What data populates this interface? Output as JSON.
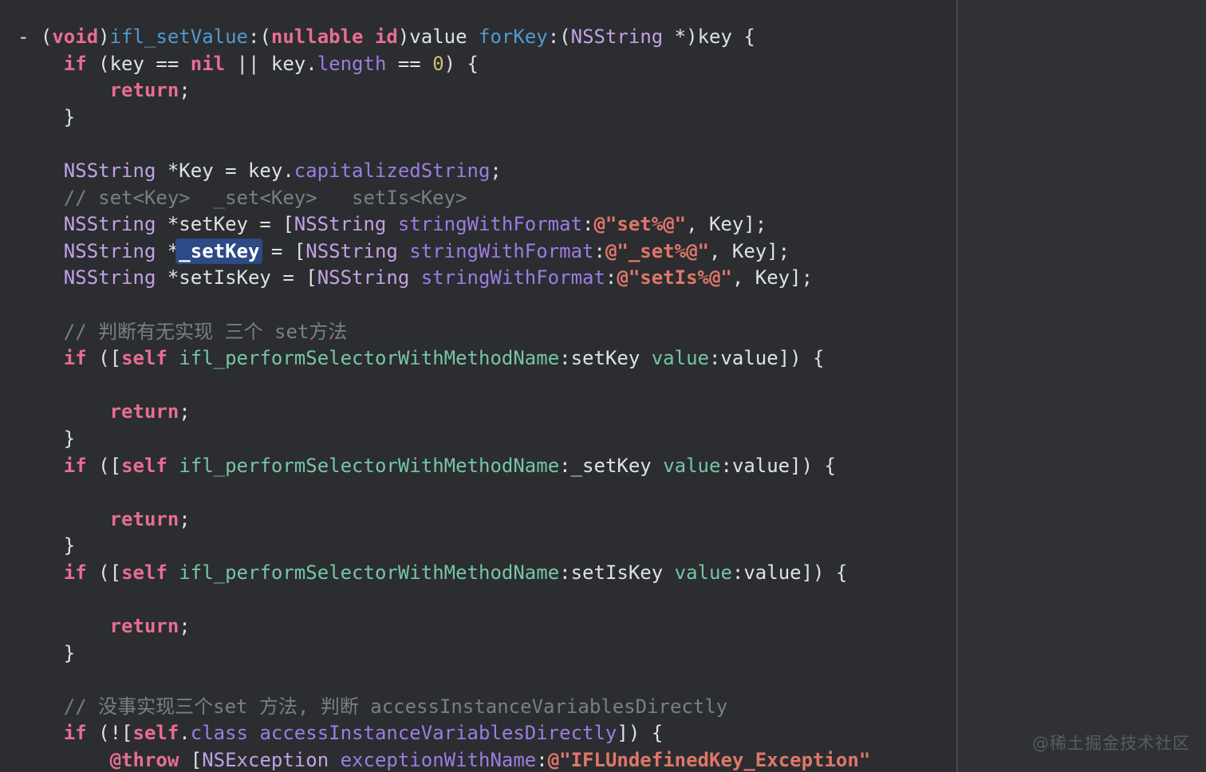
{
  "editor": {
    "language": "objective-c",
    "background": "#2b2d30",
    "panel_background": "#2f3136",
    "divider_color": "#47494e",
    "selection_color": "#2b4a86",
    "lines": [
      {
        "tokens": [
          [
            "w",
            "- ("
          ],
          [
            "k",
            "void"
          ],
          [
            "w",
            ")"
          ],
          [
            "m",
            "ifl_setValue"
          ],
          [
            "w",
            ":("
          ],
          [
            "k",
            "nullable id"
          ],
          [
            "w",
            ")value "
          ],
          [
            "m",
            "forKey"
          ],
          [
            "w",
            ":("
          ],
          [
            "cls",
            "NSString"
          ],
          [
            "w",
            " *)key {"
          ]
        ]
      },
      {
        "tokens": [
          [
            "w",
            "    "
          ],
          [
            "k",
            "if"
          ],
          [
            "w",
            " (key == "
          ],
          [
            "k",
            "nil"
          ],
          [
            "w",
            " || key."
          ],
          [
            "p",
            "length"
          ],
          [
            "w",
            " == "
          ],
          [
            "n",
            "0"
          ],
          [
            "w",
            ") {"
          ]
        ]
      },
      {
        "tokens": [
          [
            "w",
            "        "
          ],
          [
            "k",
            "return"
          ],
          [
            "w",
            ";"
          ]
        ]
      },
      {
        "tokens": [
          [
            "w",
            "    }"
          ]
        ]
      },
      {
        "tokens": []
      },
      {
        "tokens": [
          [
            "w",
            "    "
          ],
          [
            "cls",
            "NSString"
          ],
          [
            "w",
            " *Key = key."
          ],
          [
            "p",
            "capitalizedString"
          ],
          [
            "w",
            ";"
          ]
        ]
      },
      {
        "tokens": [
          [
            "c",
            "    // set<Key>  _set<Key>   setIs<Key>"
          ]
        ]
      },
      {
        "tokens": [
          [
            "w",
            "    "
          ],
          [
            "cls",
            "NSString"
          ],
          [
            "w",
            " *setKey = ["
          ],
          [
            "cls",
            "NSString"
          ],
          [
            "w",
            " "
          ],
          [
            "p",
            "stringWithFormat"
          ],
          [
            "w",
            ":"
          ],
          [
            "s",
            "@\"set%@\""
          ],
          [
            "w",
            ", Key];"
          ]
        ]
      },
      {
        "tokens": [
          [
            "w",
            "    "
          ],
          [
            "cls",
            "NSString"
          ],
          [
            "w",
            " *"
          ],
          [
            "sel",
            "_setKey"
          ],
          [
            "w",
            " = ["
          ],
          [
            "cls",
            "NSString"
          ],
          [
            "w",
            " "
          ],
          [
            "p",
            "stringWithFormat"
          ],
          [
            "w",
            ":"
          ],
          [
            "s",
            "@\"_set%@\""
          ],
          [
            "w",
            ", Key];"
          ]
        ]
      },
      {
        "tokens": [
          [
            "w",
            "    "
          ],
          [
            "cls",
            "NSString"
          ],
          [
            "w",
            " *setIsKey = ["
          ],
          [
            "cls",
            "NSString"
          ],
          [
            "w",
            " "
          ],
          [
            "p",
            "stringWithFormat"
          ],
          [
            "w",
            ":"
          ],
          [
            "s",
            "@\"setIs%@\""
          ],
          [
            "w",
            ", Key];"
          ]
        ]
      },
      {
        "tokens": []
      },
      {
        "tokens": [
          [
            "c",
            "    // 判断有无实现 三个 set方法"
          ]
        ]
      },
      {
        "tokens": [
          [
            "w",
            "    "
          ],
          [
            "k",
            "if"
          ],
          [
            "w",
            " (["
          ],
          [
            "k",
            "self"
          ],
          [
            "w",
            " "
          ],
          [
            "t",
            "ifl_performSelectorWithMethodName"
          ],
          [
            "w",
            ":setKey "
          ],
          [
            "t",
            "value"
          ],
          [
            "w",
            ":value]) {"
          ]
        ]
      },
      {
        "tokens": []
      },
      {
        "tokens": [
          [
            "w",
            "        "
          ],
          [
            "k",
            "return"
          ],
          [
            "w",
            ";"
          ]
        ]
      },
      {
        "tokens": [
          [
            "w",
            "    }"
          ]
        ]
      },
      {
        "tokens": [
          [
            "w",
            "    "
          ],
          [
            "k",
            "if"
          ],
          [
            "w",
            " (["
          ],
          [
            "k",
            "self"
          ],
          [
            "w",
            " "
          ],
          [
            "t",
            "ifl_performSelectorWithMethodName"
          ],
          [
            "w",
            ":_setKey "
          ],
          [
            "t",
            "value"
          ],
          [
            "w",
            ":value]) {"
          ]
        ]
      },
      {
        "tokens": []
      },
      {
        "tokens": [
          [
            "w",
            "        "
          ],
          [
            "k",
            "return"
          ],
          [
            "w",
            ";"
          ]
        ]
      },
      {
        "tokens": [
          [
            "w",
            "    }"
          ]
        ]
      },
      {
        "tokens": [
          [
            "w",
            "    "
          ],
          [
            "k",
            "if"
          ],
          [
            "w",
            " (["
          ],
          [
            "k",
            "self"
          ],
          [
            "w",
            " "
          ],
          [
            "t",
            "ifl_performSelectorWithMethodName"
          ],
          [
            "w",
            ":setIsKey "
          ],
          [
            "t",
            "value"
          ],
          [
            "w",
            ":value]) {"
          ]
        ]
      },
      {
        "tokens": []
      },
      {
        "tokens": [
          [
            "w",
            "        "
          ],
          [
            "k",
            "return"
          ],
          [
            "w",
            ";"
          ]
        ]
      },
      {
        "tokens": [
          [
            "w",
            "    }"
          ]
        ]
      },
      {
        "tokens": []
      },
      {
        "tokens": [
          [
            "c",
            "    // 没事实现三个set 方法, 判断 accessInstanceVariablesDirectly"
          ]
        ]
      },
      {
        "tokens": [
          [
            "w",
            "    "
          ],
          [
            "k",
            "if"
          ],
          [
            "w",
            " (!["
          ],
          [
            "k",
            "self"
          ],
          [
            "w",
            "."
          ],
          [
            "p",
            "class"
          ],
          [
            "w",
            " "
          ],
          [
            "p",
            "accessInstanceVariablesDirectly"
          ],
          [
            "w",
            "]) {"
          ]
        ]
      },
      {
        "tokens": [
          [
            "w",
            "        "
          ],
          [
            "k",
            "@throw"
          ],
          [
            "w",
            " ["
          ],
          [
            "cls",
            "NSException"
          ],
          [
            "w",
            " "
          ],
          [
            "p",
            "exceptionWithName"
          ],
          [
            "w",
            ":"
          ],
          [
            "s",
            "@\"IFLUndefinedKey_Exception\""
          ]
        ]
      }
    ]
  },
  "colors": {
    "w": "#dee1e6",
    "k": "#e86d92",
    "m": "#5499cd",
    "cls": "#c3a1e5",
    "p": "#9d7ce2",
    "s": "#e0766a",
    "n": "#d5be74",
    "c": "#7a7e88",
    "t": "#76c5a5",
    "sel": "#ffffff"
  },
  "watermark": {
    "text": "@稀土掘金技术社区"
  }
}
